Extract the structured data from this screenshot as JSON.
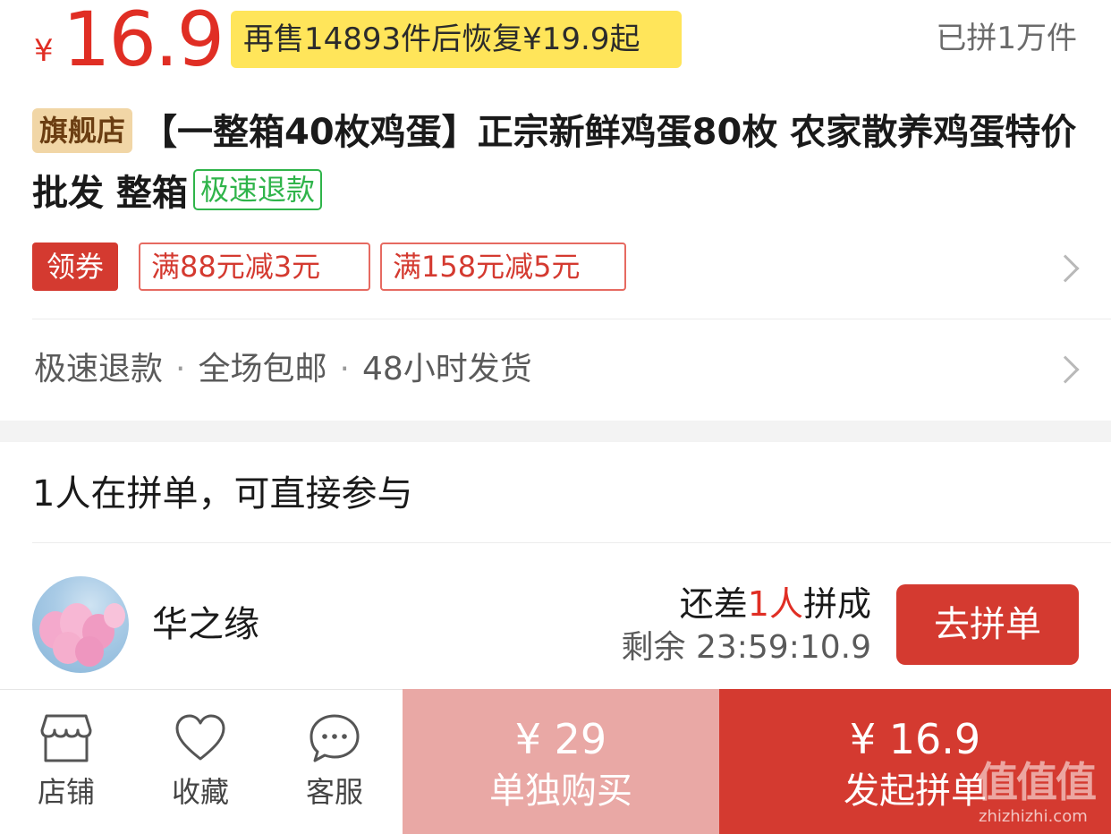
{
  "price": {
    "currency": "¥",
    "amount": "16.9",
    "restock_notice": "再售14893件后恢复¥19.9起",
    "sold_count": "已拼1万件"
  },
  "product": {
    "store_badge": "旗舰店",
    "title": "【一整箱40枚鸡蛋】正宗新鲜鸡蛋80枚 农家散养鸡蛋特价批发 整箱",
    "refund_badge": "极速退款"
  },
  "coupons": {
    "label": "领券",
    "items": [
      "满88元减3元",
      "满158元减5元"
    ]
  },
  "services": {
    "items": [
      "极速退款",
      "全场包邮",
      "48小时发货"
    ],
    "separator": "·"
  },
  "group": {
    "heading": "1人在拼单，可直接参与",
    "member_name": "华之缘",
    "need_prefix": "还差",
    "need_count": "1人",
    "need_suffix": "拼成",
    "remaining": "剩余 23:59:10.9",
    "join_label": "去拼单"
  },
  "bottom_bar": {
    "store_label": "店铺",
    "favorite_label": "收藏",
    "service_label": "客服",
    "buy_alone_price": "¥ 29",
    "buy_alone_label": "单独购买",
    "buy_group_price": "¥ 16.9",
    "buy_group_label": "发起拼单"
  },
  "watermark": {
    "logo": "值值值",
    "url": "zhizhizhi.com"
  },
  "colors": {
    "brand_red": "#d43a30",
    "price_red": "#e02e24",
    "restock_yellow": "#ffe55a",
    "refund_green": "#2fb44a",
    "buy_alone_pink": "#e9a8a5"
  }
}
